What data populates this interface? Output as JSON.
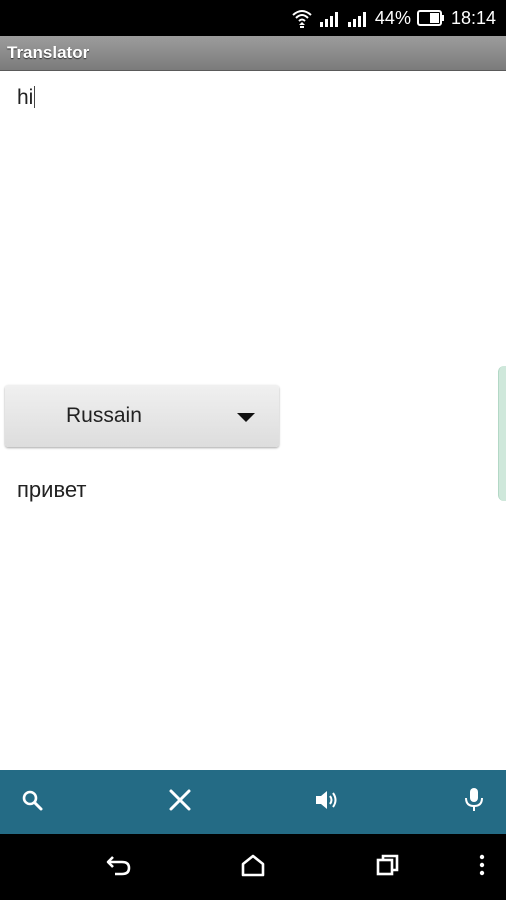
{
  "status_bar": {
    "battery": "44%",
    "time": "18:14",
    "icons": [
      "wifi-icon",
      "signal-icon",
      "signal-icon",
      "battery-icon"
    ]
  },
  "app": {
    "title": "Translator"
  },
  "input": {
    "value": "hi"
  },
  "language_select": {
    "selected": "Russain"
  },
  "output": {
    "text": "привет"
  },
  "toolbar": {
    "icons": [
      "search-icon",
      "close-icon",
      "speaker-icon",
      "mic-icon"
    ],
    "color": "#246b85"
  },
  "nav": {
    "icons": [
      "back-icon",
      "home-icon",
      "recents-icon",
      "overflow-menu-icon"
    ]
  }
}
